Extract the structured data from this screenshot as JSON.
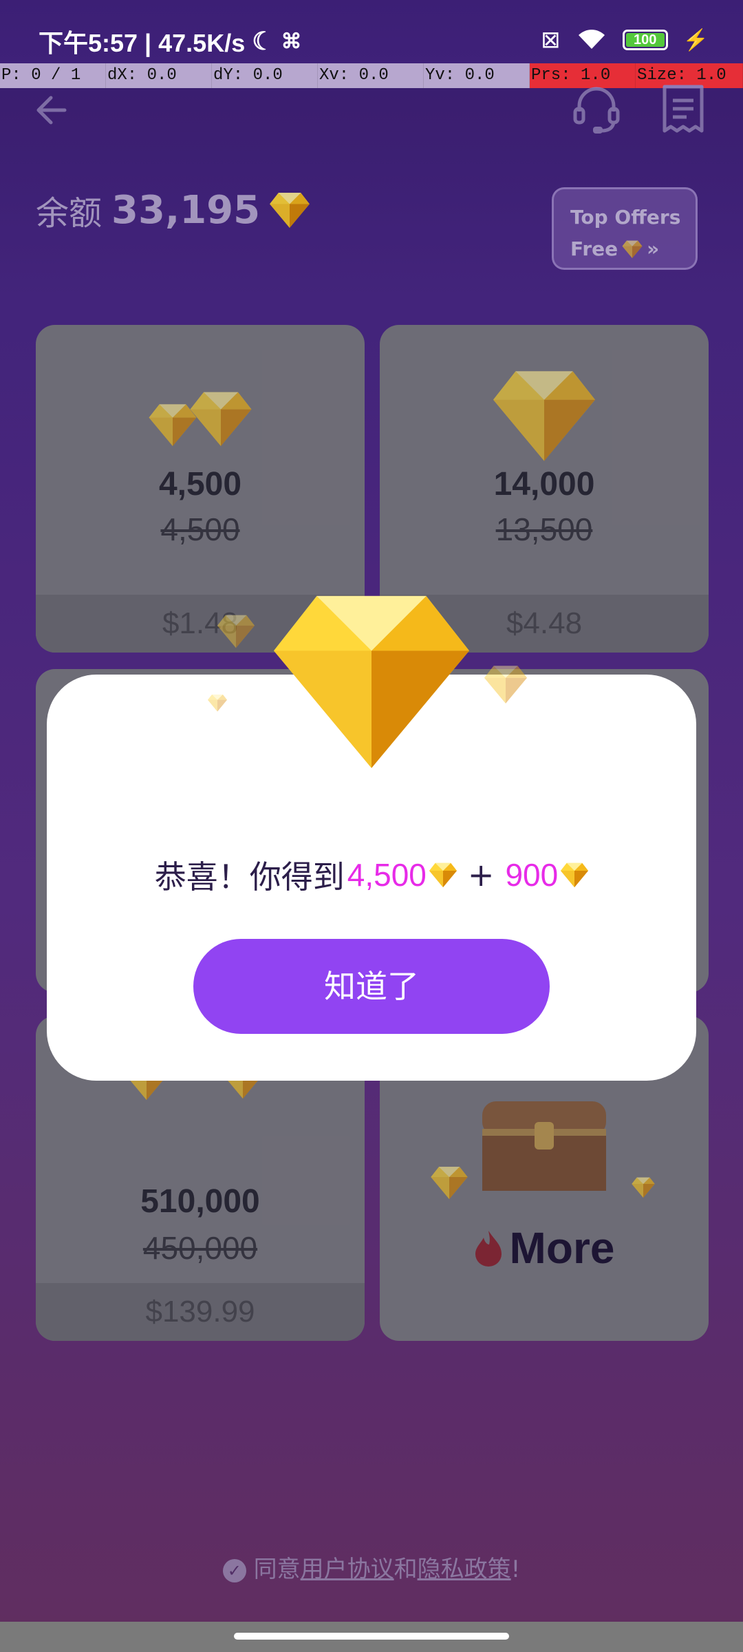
{
  "status_bar": {
    "time_net": "下午5:57 | 47.5K/s",
    "battery": "100"
  },
  "debug_bar": [
    "P: 0 / 1",
    "dX: 0.0",
    "dY: 0.0",
    "Xv: 0.0",
    "Yv: 0.0",
    "Prs: 1.0",
    "Size: 1.0"
  ],
  "header": {
    "balance_label": "余额",
    "balance_value": "33,195",
    "top_offers_line1": "Top Offers",
    "top_offers_line2": "Free"
  },
  "cards": [
    {
      "amount": "4,500",
      "original": "4,500",
      "price": "$1.48"
    },
    {
      "amount": "14,000",
      "original": "13,500",
      "price": "$4.48"
    },
    {
      "amount": "510,000",
      "original": "450,000",
      "price": "$139.99"
    }
  ],
  "more_card": {
    "label": "More"
  },
  "agreement": {
    "prefix": "同意",
    "terms": "用户协议",
    "and": "和",
    "privacy": "隐私政策",
    "suffix": "!"
  },
  "dialog": {
    "message_prefix": "恭喜！你得到",
    "amount": "4,500",
    "plus": "+",
    "bonus": "900",
    "button_label": "知道了"
  },
  "colors": {
    "accent": "#9144f2",
    "highlight": "#e72be8"
  }
}
